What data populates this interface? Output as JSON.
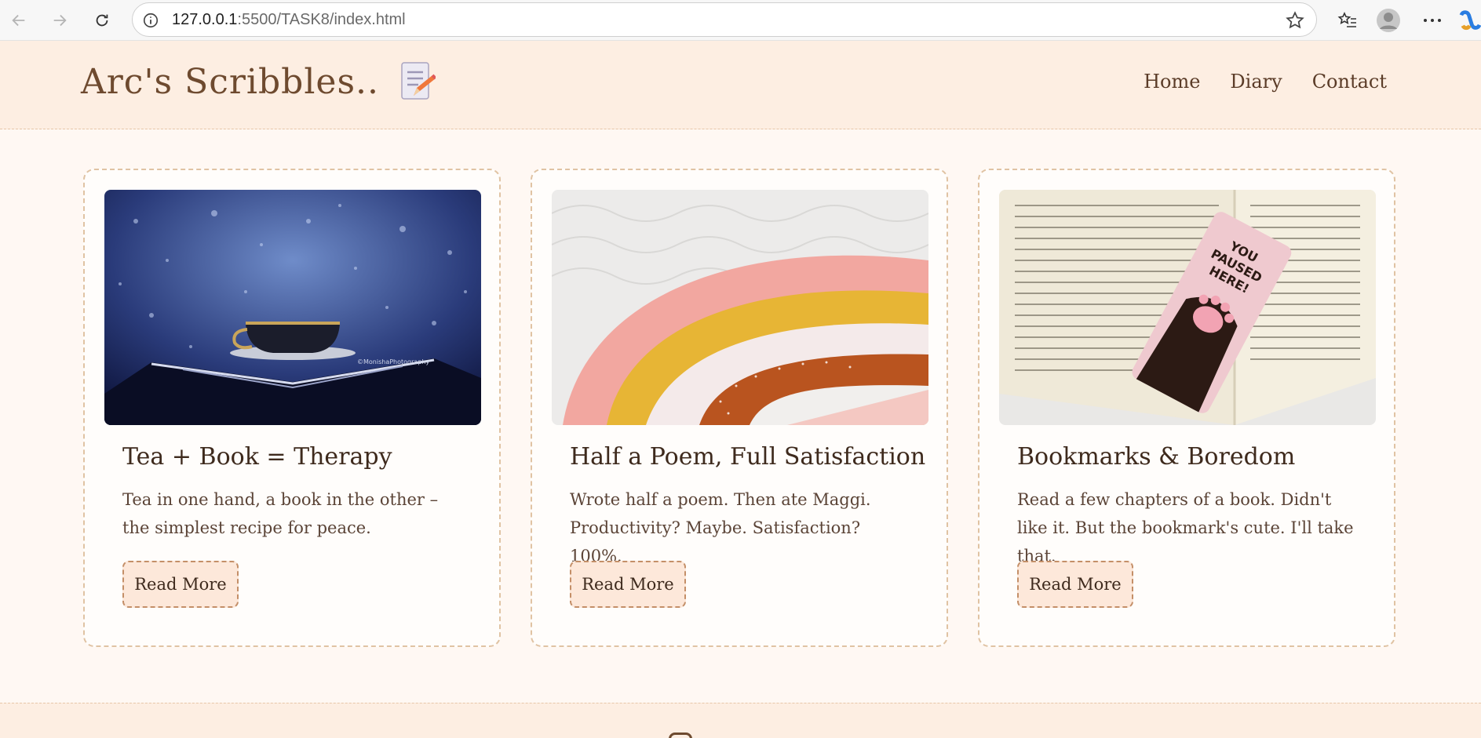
{
  "browser": {
    "url_host": "127.0.0.1",
    "url_rest": ":5500/TASK8/index.html",
    "icons": [
      "back-icon",
      "forward-icon",
      "reload-icon",
      "info-icon",
      "star-icon",
      "favorites-icon",
      "profile-icon",
      "more-icon",
      "copilot-icon"
    ]
  },
  "site": {
    "logo_text": "Arc's Scribbles..",
    "nav": [
      "Home",
      "Diary",
      "Contact"
    ]
  },
  "cards": [
    {
      "title": "Tea + Book = Therapy",
      "text": "Tea in one hand, a book in the other – the simplest recipe for peace.",
      "button": "Read More",
      "image_watermark": "©MonishaPhotography"
    },
    {
      "title": "Half a Poem, Full Satisfaction",
      "text": "Wrote half a poem. Then ate Maggi. Productivity? Maybe. Satisfaction? 100%.",
      "button": "Read More"
    },
    {
      "title": "Bookmarks & Boredom",
      "text": "Read a few chapters of a book. Didn't like it. But the bookmark's cute. I'll take that.",
      "button": "Read More",
      "bookmark_text": [
        "YOU",
        "PAUSED",
        "HERE!"
      ]
    }
  ],
  "colors": {
    "header_bg": "#fdeee2",
    "page_bg": "#fff8f3",
    "card_border": "#e0c3a3",
    "brown": "#6e4a2f"
  }
}
